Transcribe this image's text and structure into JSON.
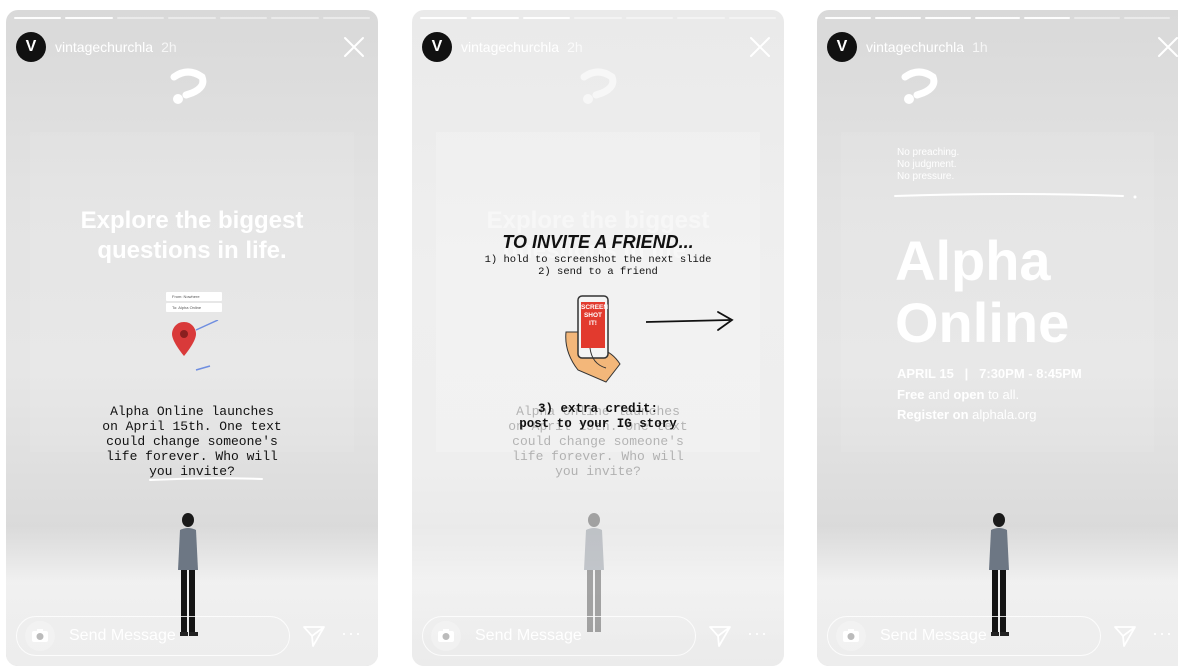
{
  "stories": [
    {
      "username": "vintagechurchla",
      "time": "2h",
      "avatar_letter": "V",
      "heading": "Explore the biggest questions in life.",
      "map": {
        "from": "From: Nowhere",
        "to": "To: Alpha Online"
      },
      "body": "Alpha Online launches\non April 15th. One text\ncould change someone's\nlife forever. Who will\nyou invite?",
      "message_placeholder": "Send Message",
      "more": "···"
    },
    {
      "username": "vintagechurchla",
      "time": "2h",
      "avatar_letter": "V",
      "ghost_heading": "Explore the biggest questions in life.",
      "title": "TO INVITE A FRIEND...",
      "steps": "1) hold to screenshot the next slide\n2) send to a friend",
      "phone_text": "SCREEN\nSHOT\nIT!",
      "step3": "3) extra credit:\npost to your IG story",
      "ghost_body": "Alpha Online launches\non April 15th. One text\ncould change someone's\nlife forever. Who will\nyou invite?",
      "message_placeholder": "Send Message",
      "more": "···"
    },
    {
      "username": "vintagechurchla",
      "time": "1h",
      "avatar_letter": "V",
      "taglines": [
        "No preaching.",
        "No judgment.",
        "No pressure."
      ],
      "title_line1": "Alpha",
      "title_line2": "Online",
      "date_line": "APRIL 15   |   7:30PM - 8:45PM",
      "free_bold": "Free",
      "free_rest1": " and ",
      "open_bold": "open",
      "free_rest2": " to all.",
      "register_bold": "Register on",
      "register_site": " alphala.org",
      "message_placeholder": "Send Message",
      "more": "···"
    }
  ],
  "colors": {
    "pin": "#d93a3a",
    "accent_white": "#ffffff"
  },
  "icons": [
    "camera-icon",
    "direct-send-icon",
    "close-icon",
    "question-logo-icon",
    "map-pin-icon",
    "arrow-icon",
    "phone-hand-icon"
  ]
}
